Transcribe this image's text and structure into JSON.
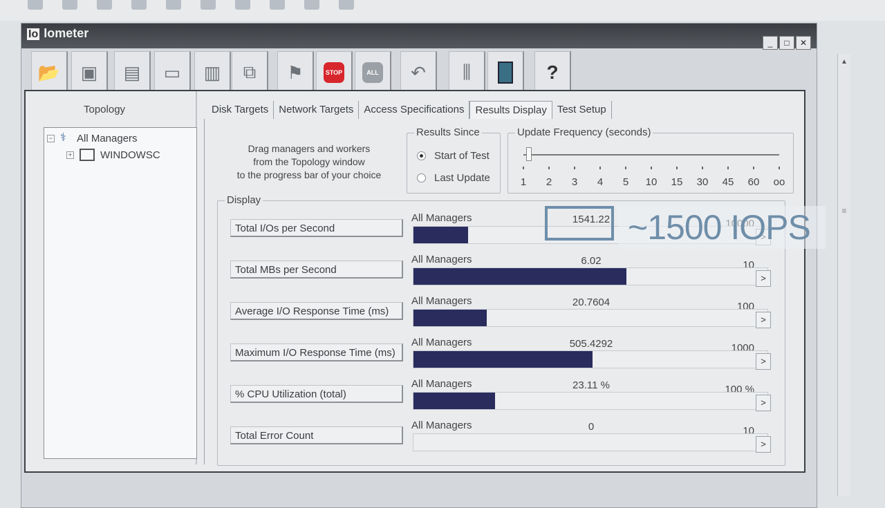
{
  "window": {
    "title": "Iometer",
    "title_prefix": "Io"
  },
  "window_controls": {
    "minimize": "_",
    "maximize": "□",
    "close": "✕"
  },
  "topology": {
    "title": "Topology",
    "tree": [
      {
        "label": "All Managers",
        "expander": "−"
      },
      {
        "label": "WINDOWSC",
        "expander": "+"
      }
    ]
  },
  "tabs": [
    {
      "label": "Disk Targets"
    },
    {
      "label": "Network Targets"
    },
    {
      "label": "Access Specifications"
    },
    {
      "label": "Results Display"
    },
    {
      "label": "Test Setup"
    }
  ],
  "active_tab": "Results Display",
  "drag_instructions": [
    "Drag managers and workers",
    "from the Topology window",
    "to the progress bar of your choice"
  ],
  "results_since": {
    "legend": "Results Since",
    "options": [
      "Start of Test",
      "Last Update"
    ],
    "selected": "Start of Test"
  },
  "update_frequency": {
    "legend": "Update Frequency (seconds)",
    "ticks": [
      "1",
      "2",
      "3",
      "4",
      "5",
      "10",
      "15",
      "30",
      "45",
      "60",
      "oo"
    ],
    "selected": "1"
  },
  "display": {
    "legend": "Display",
    "metrics": [
      {
        "label": "Total I/Os per Second",
        "source": "All Managers",
        "value": "1541.22",
        "max": "10000",
        "fraction": 0.154
      },
      {
        "label": "Total MBs per Second",
        "source": "All Managers",
        "value": "6.02",
        "max": "10",
        "fraction": 0.602
      },
      {
        "label": "Average I/O Response Time (ms)",
        "source": "All Managers",
        "value": "20.7604",
        "max": "100",
        "fraction": 0.208
      },
      {
        "label": "Maximum I/O Response Time (ms)",
        "source": "All Managers",
        "value": "505.4292",
        "max": "1000",
        "fraction": 0.505
      },
      {
        "label": "% CPU Utilization (total)",
        "source": "All Managers",
        "value": "23.11 %",
        "max": "100 %",
        "fraction": 0.231
      },
      {
        "label": "Total Error Count",
        "source": "All Managers",
        "value": "0",
        "max": "10",
        "fraction": 0
      }
    ],
    "more_label": ">"
  },
  "annotation": {
    "text": "~1500 IOPS",
    "color": "#6f8ea9"
  },
  "colors": {
    "bar_fill": "#2a2c5e",
    "stop_red": "#d8262d",
    "titlebar": "#3a3d42"
  }
}
